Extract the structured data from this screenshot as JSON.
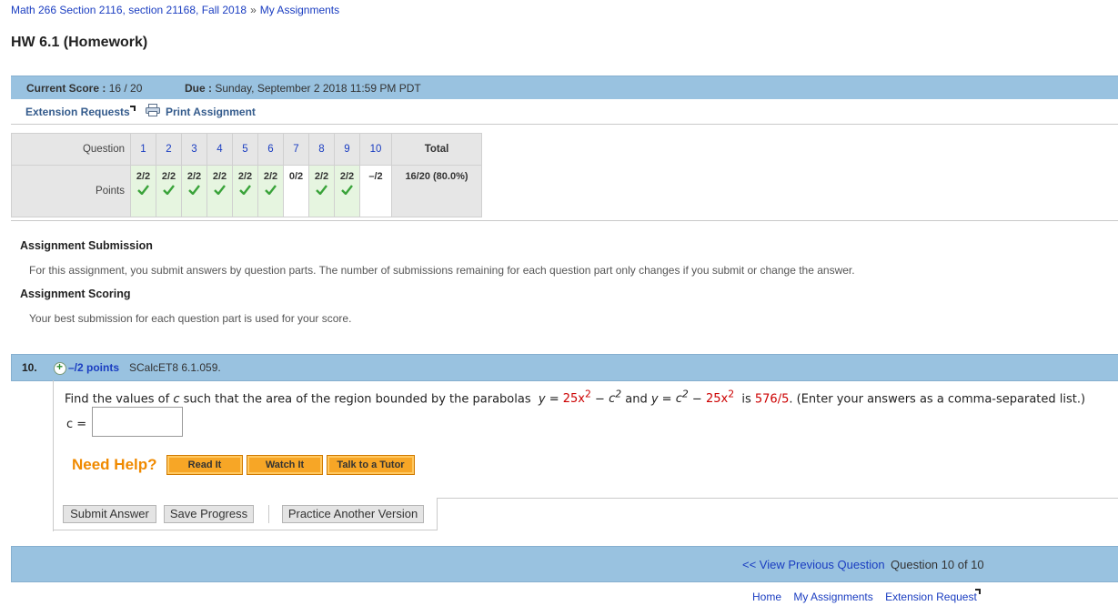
{
  "breadcrumb": {
    "course": "Math 266 Section 2116, section 21168, Fall 2018",
    "sep": "»",
    "current": "My Assignments"
  },
  "title": "HW 6.1 (Homework)",
  "score_bar": {
    "score_label": "Current Score :",
    "score_value": "16 / 20",
    "due_label": "Due :",
    "due_value": "Sunday, September 2 2018 11:59 PM PDT"
  },
  "links": {
    "extension": "Extension Requests",
    "print": "Print Assignment"
  },
  "grid": {
    "question_label": "Question",
    "points_label": "Points",
    "total_label": "Total",
    "questions": [
      "1",
      "2",
      "3",
      "4",
      "5",
      "6",
      "7",
      "8",
      "9",
      "10"
    ],
    "points": [
      "2/2",
      "2/2",
      "2/2",
      "2/2",
      "2/2",
      "2/2",
      "0/2",
      "2/2",
      "2/2",
      "–/2"
    ],
    "correct": [
      true,
      true,
      true,
      true,
      true,
      true,
      false,
      true,
      true,
      false
    ],
    "total_value": "16/20 (80.0%)"
  },
  "submission": {
    "heading": "Assignment Submission",
    "text": "For this assignment, you submit answers by question parts. The number of submissions remaining for each question part only changes if you submit or change the answer."
  },
  "scoring": {
    "heading": "Assignment Scoring",
    "text": "Your best submission for each question part is used for your score."
  },
  "question": {
    "number": "10.",
    "points": "–/2 points",
    "source": "SCalcET8 6.1.059.",
    "text_prefix": "Find the values of",
    "var_c": "c",
    "text_mid1": "such that the area of the region bounded by the parabolas",
    "eq1_lhs": "y =",
    "eq1_rhs": "25x",
    "eq1_sup": "2",
    "eq1_minus": "−",
    "eq1_c": "c",
    "and": "and",
    "eq2_lhs": "y =",
    "eq2_c": "c",
    "eq2_minus": "−",
    "eq2_rhs": "25x",
    "is": "is",
    "area": "576/5",
    "suffix": ". (Enter your answers as a comma-separated list.)",
    "answer_label": "c =",
    "answer_value": ""
  },
  "help": {
    "label": "Need Help?",
    "read": "Read It",
    "watch": "Watch It",
    "tutor": "Talk to a Tutor"
  },
  "actions": {
    "submit": "Submit Answer",
    "save": "Save Progress",
    "practice": "Practice Another Version"
  },
  "nav": {
    "prev": "<< View Previous Question",
    "count": "Question 10 of 10"
  },
  "footer": {
    "home": "Home",
    "assignments": "My Assignments",
    "extension": "Extension Request"
  }
}
